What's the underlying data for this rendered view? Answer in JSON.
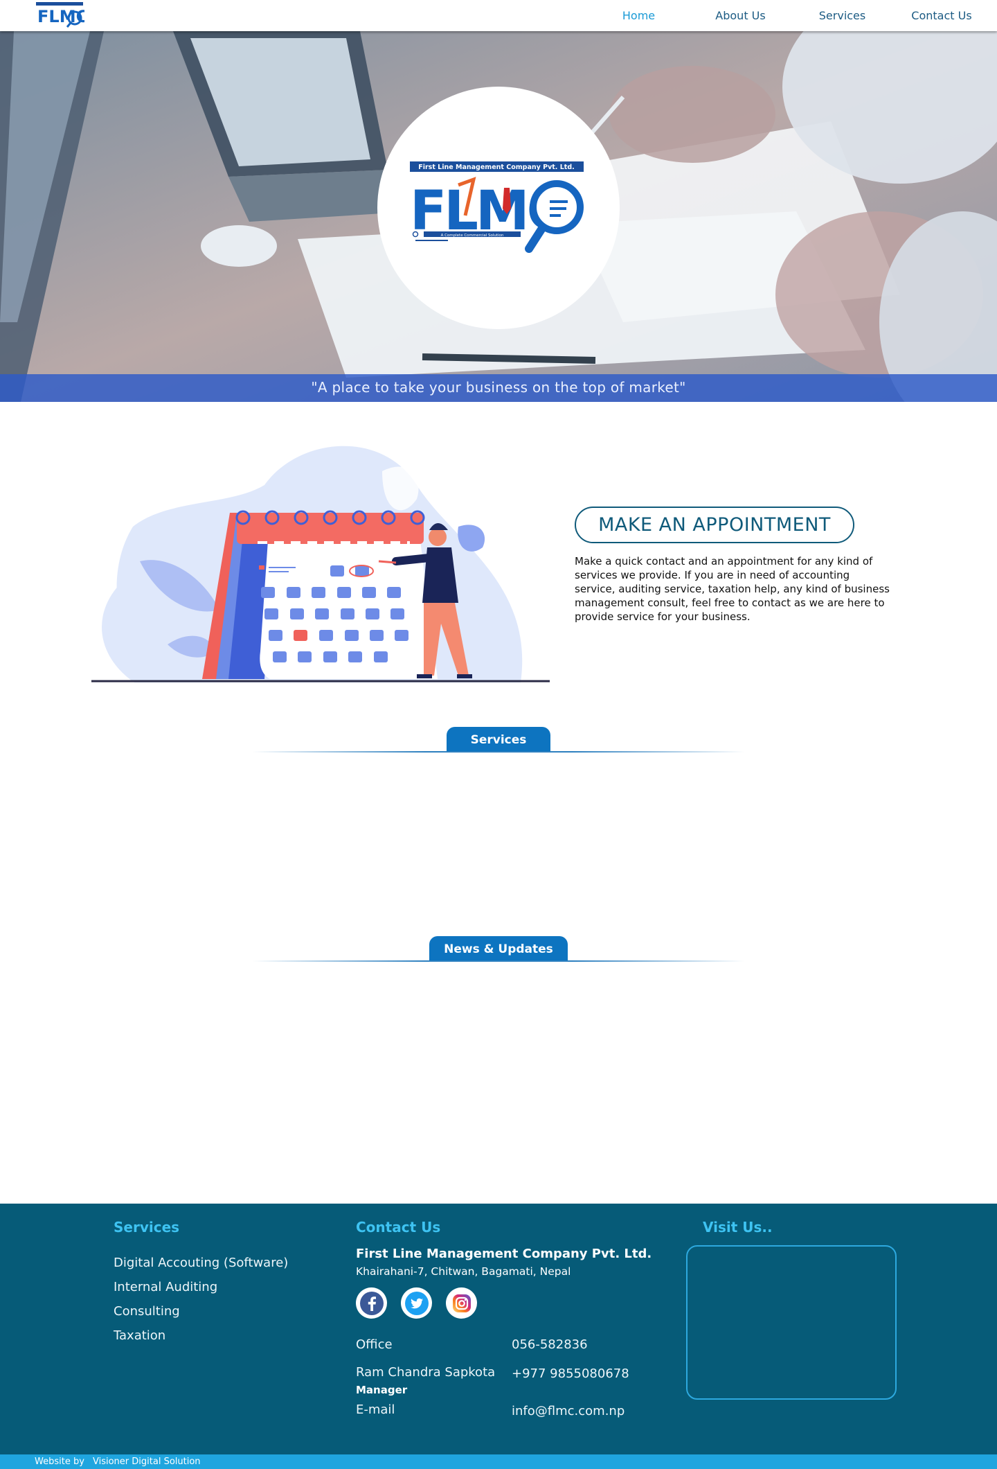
{
  "nav": {
    "logo_text": "FLMC",
    "items": [
      "Home",
      "About Us",
      "Services",
      "Contact Us"
    ],
    "active": "Home"
  },
  "hero": {
    "logo_banner": "First Line Management Company Pvt. Ltd.",
    "logo_letters": "FLMC",
    "logo_tagline": "A Complete Commercial Solution",
    "tagline": "\"A place to take your business on the top of market\""
  },
  "appointment": {
    "button_label": "MAKE AN APPOINTMENT",
    "description": "Make a quick contact and an appointment for any kind of services we provide. If you are in need of accounting service, auditing service, taxation help, any kind of business management consult, feel free to contact as we are here to provide service for your business."
  },
  "sections": {
    "services_label": "Services",
    "news_label": "News & Updates"
  },
  "footer": {
    "services_heading": "Services",
    "services_items": [
      "Digital Accouting (Software)",
      "Internal Auditing",
      "Consulting",
      "Taxation"
    ],
    "contact_heading": "Contact Us",
    "company_name": "First Line Management Company Pvt. Ltd.",
    "address": "Khairahani-7, Chitwan, Bagamati, Nepal",
    "socials": [
      "facebook-icon",
      "twitter-icon",
      "instagram-icon"
    ],
    "office_label": "Office",
    "office_phone": "056-582836",
    "manager_name": "Ram Chandra Sapkota",
    "manager_role": "Manager",
    "manager_phone": "+977 9855080678",
    "email_label": "E-mail",
    "email": "info@flmc.com.np",
    "visit_heading": "Visit Us.."
  },
  "bottom_bar": {
    "credit_label": "Website by",
    "credit_name": "Visioner Digital Solution"
  },
  "colors": {
    "nav_text": "#1c5b83",
    "nav_active": "#1a9ad6",
    "brand_blue": "#0d74c0",
    "footer_bg": "#065b78",
    "footer_heading": "#3ec3f2",
    "hero_band": "#2d5ac8",
    "bottom_bar": "#1fa5df"
  }
}
